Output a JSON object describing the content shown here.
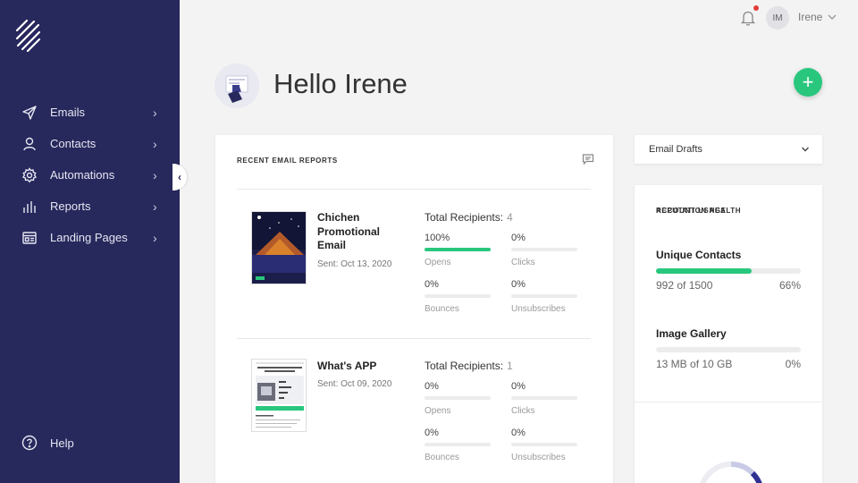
{
  "sidebar": {
    "items": [
      {
        "label": "Emails",
        "icon": "paper-plane-icon"
      },
      {
        "label": "Contacts",
        "icon": "person-icon"
      },
      {
        "label": "Automations",
        "icon": "gear-icon"
      },
      {
        "label": "Reports",
        "icon": "bar-chart-icon"
      },
      {
        "label": "Landing Pages",
        "icon": "landing-page-icon"
      }
    ],
    "help_label": "Help"
  },
  "topbar": {
    "initials": "IM",
    "username": "Irene"
  },
  "greeting": "Hello Irene",
  "reports": {
    "title": "RECENT EMAIL REPORTS",
    "items": [
      {
        "name": "Chichen Promotional Email",
        "sent": "Sent: Oct 13, 2020",
        "recipients_label": "Total Recipients:",
        "recipients": "4",
        "metrics": [
          {
            "value": "100%",
            "label": "Opens",
            "fill": 1.0
          },
          {
            "value": "0%",
            "label": "Clicks",
            "fill": 0
          },
          {
            "value": "0%",
            "label": "Bounces",
            "fill": 0
          },
          {
            "value": "0%",
            "label": "Unsubscribes",
            "fill": 0
          }
        ]
      },
      {
        "name": "What's APP",
        "sent": "Sent: Oct 09, 2020",
        "recipients_label": "Total Recipients:",
        "recipients": "1",
        "metrics": [
          {
            "value": "0%",
            "label": "Opens",
            "fill": 0
          },
          {
            "value": "0%",
            "label": "Clicks",
            "fill": 0
          },
          {
            "value": "0%",
            "label": "Bounces",
            "fill": 0
          },
          {
            "value": "0%",
            "label": "Unsubscribes",
            "fill": 0
          }
        ]
      }
    ]
  },
  "drafts": {
    "label": "Email Drafts"
  },
  "usage": {
    "title": "ACCOUNT USAGE",
    "items": [
      {
        "name": "Unique Contacts",
        "used": "992 of 1500",
        "percent": "66%",
        "fill": 0.66
      },
      {
        "name": "Image Gallery",
        "used": "13 MB of 10 GB",
        "percent": "0%",
        "fill": 0
      }
    ],
    "reputation_title": "REPUTATION HEALTH"
  },
  "colors": {
    "sidebar": "#27285c",
    "accent_green": "#29c77d",
    "notification_dot": "#e23b3b"
  }
}
